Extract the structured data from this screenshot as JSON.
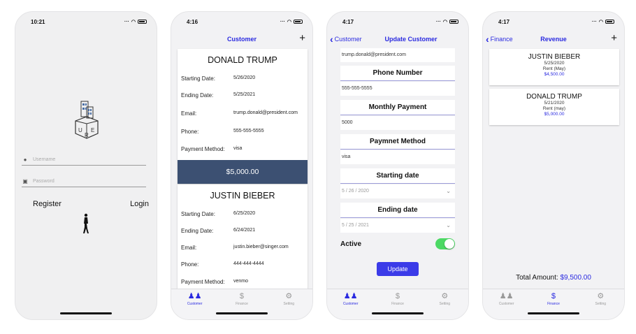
{
  "login_screen": {
    "time": "10:21",
    "username_placeholder": "Username",
    "password_placeholder": "Password",
    "register_label": "Register",
    "login_label": "Login",
    "logo_letters": [
      "U",
      "R",
      "E"
    ]
  },
  "customer_list": {
    "time": "4:16",
    "title": "Customer",
    "add_label": "+",
    "labels": {
      "start": "Starting Date:",
      "end": "Ending Date:",
      "email": "Email:",
      "phone": "Phone:",
      "payment": "Payment Method:"
    },
    "customers": [
      {
        "name": "DONALD TRUMP",
        "start": "5/26/2020",
        "end": "5/25/2021",
        "email": "trump.donald@president.com",
        "phone": "555-555-5555",
        "payment": "visa",
        "amount": "$5,000.00"
      },
      {
        "name": "JUSTIN BIEBER",
        "start": "6/25/2020",
        "end": "6/24/2021",
        "email": "justin.bieber@singer.com",
        "phone": "444-444-4444",
        "payment": "venmo"
      }
    ]
  },
  "update_customer": {
    "time": "4:17",
    "back_label": "Customer",
    "title": "Update Customer",
    "email_value": "trump.donald@president.com",
    "phone_label": "Phone Number",
    "phone_value": "555-555-5555",
    "monthly_label": "Monthly Payment",
    "monthly_value": "5000",
    "method_label": "Paymnet Method",
    "method_value": "visa",
    "start_label": "Starting date",
    "start_value": "5 / 26 / 2020",
    "end_label": "Ending date",
    "end_value": "5 / 25 / 2021",
    "active_label": "Active",
    "active_on": true,
    "update_label": "Update"
  },
  "revenue": {
    "time": "4:17",
    "back_label": "Finance",
    "title": "Revenue",
    "add_label": "+",
    "entries": [
      {
        "name": "JUSTIN BIEBER",
        "date": "5/25/2020",
        "desc": "Rent (May)",
        "amount": "$4,500.00"
      },
      {
        "name": "DONALD TRUMP",
        "date": "5/21/2020",
        "desc": "Rent (may)",
        "amount": "$5,000.00"
      }
    ],
    "total_label": "Total Amount:",
    "total_value": "$9,500.00"
  },
  "tabs": {
    "customer": "Customer",
    "finance": "Finance",
    "setting": "Setting",
    "customer_icon": "people-icon",
    "finance_icon": "dollar-icon",
    "setting_icon": "gear-icon"
  },
  "colors": {
    "accent": "#2a2ae0",
    "amount_bar": "#3c5072",
    "toggle_on": "#4cd964",
    "update_button": "#3b3be8"
  }
}
